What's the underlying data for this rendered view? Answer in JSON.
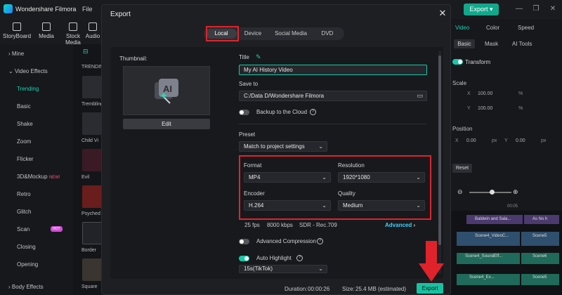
{
  "app": {
    "name": "Wondershare Filmora",
    "menu_file": "File",
    "export_label": "Export"
  },
  "toolbar": [
    {
      "label": "StoryBoard",
      "icon": "storyboard-icon"
    },
    {
      "label": "Media",
      "icon": "media-icon"
    },
    {
      "label": "Stock Media",
      "icon": "stock-media-icon"
    },
    {
      "label": "Audio",
      "icon": "audio-icon"
    }
  ],
  "sidebar": {
    "mine": "Mine",
    "video_effects": "Video Effects",
    "items": [
      "Trending",
      "Basic",
      "Shake",
      "Zoom",
      "Flicker",
      "3D&Mockup",
      "Retro",
      "Glitch",
      "Scan",
      "Closing",
      "Opening"
    ],
    "new_badge": "NEW!",
    "body_effects": "Body Effects",
    "trending_short": "TRENDING"
  },
  "thumbs": [
    "Trembling",
    "Child Vi",
    "Evil",
    "Psyched",
    "Border",
    "Square"
  ],
  "right_panel": {
    "tabs": [
      "Video",
      "Color",
      "Speed"
    ],
    "subtabs": [
      "Basic",
      "Mask",
      "AI Tools"
    ],
    "transform": "Transform",
    "scale": "Scale",
    "x_label": "X",
    "x_val": "100.00",
    "y_label": "Y",
    "y_val": "100.00",
    "pct": "%",
    "position": "Position",
    "px_x_val": "0.00",
    "px_y_val": "0.00",
    "px": "px",
    "reset": "Reset",
    "time": "00:05",
    "clips": [
      "Baldwin and Sala...",
      "As his h",
      "Scene4_VideoC...",
      "Scene5",
      "Scene4_SoundEff...",
      "Scene6",
      "Scene4_Ex...",
      "Scene5"
    ]
  },
  "dialog": {
    "title": "Export",
    "tabs": [
      "Local",
      "Device",
      "Social Media",
      "DVD"
    ],
    "thumbnail_label": "Thumbnail:",
    "edit": "Edit",
    "title_label": "Title",
    "title_value": "My AI History Video",
    "save_to_label": "Save to",
    "save_to_value": "C:/Data D/Wondershare Filmora",
    "backup": "Backup to the Cloud",
    "preset_label": "Preset",
    "preset_value": "Match to project settings",
    "format_label": "Format",
    "format_value": "MP4",
    "resolution_label": "Resolution",
    "resolution_value": "1920*1080",
    "encoder_label": "Encoder",
    "encoder_value": "H.264",
    "quality_label": "Quality",
    "quality_value": "Medium",
    "fps": "25 fps",
    "bitrate": "8000 kbps",
    "color": "SDR - Rec.709",
    "advanced": "Advanced",
    "adv_compression": "Advanced Compression",
    "auto_highlight": "Auto Highlight",
    "highlight_value": "15s(TikTok)",
    "duration_label": "Duration:",
    "duration_value": "00:00:26",
    "size_label": "Size:",
    "size_value": "25.4 MB (estimated)",
    "export": "Export"
  },
  "colors": {
    "accent": "#17c9a9",
    "highlight": "#e0232b",
    "link": "#3ad4ff"
  }
}
